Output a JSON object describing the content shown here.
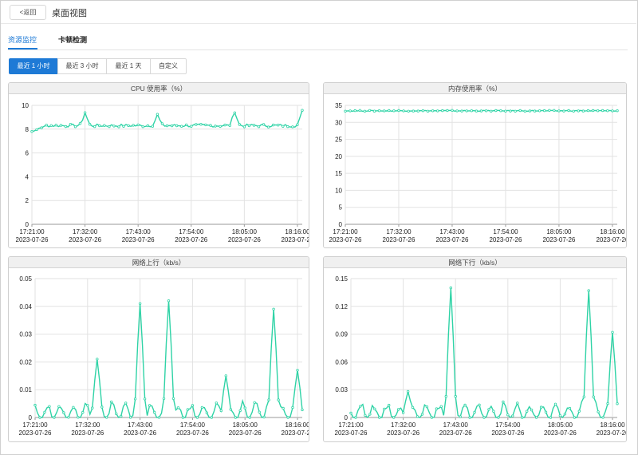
{
  "header": {
    "back_label": "<返回",
    "title": "桌面视图"
  },
  "tabs": [
    {
      "label": "资源监控",
      "active": true
    },
    {
      "label": "卡顿检测",
      "active": false
    }
  ],
  "time_range": {
    "options": [
      "最近 1 小时",
      "最近 3 小时",
      "最近 1 天",
      "自定义"
    ],
    "selected": "最近 1 小时"
  },
  "colors": {
    "accent": "#1e7ad6",
    "series": "#2fd3a6"
  },
  "chart_data": [
    {
      "type": "line",
      "title": "CPU 使用率（%）",
      "x_tick_times": [
        "17:21:00",
        "17:32:00",
        "17:43:00",
        "17:54:00",
        "18:05:00",
        "18:16:00"
      ],
      "x_tick_date": "2023-07-26",
      "x_range_minutes": [
        0,
        56
      ],
      "ylim": [
        0,
        10
      ],
      "y_ticks": [
        0,
        2,
        4,
        6,
        8,
        10
      ],
      "grid": true,
      "series": [
        {
          "peaks": [
            {
              "minute": 11,
              "value": 9.4
            },
            {
              "minute": 26,
              "value": 9.2
            },
            {
              "minute": 42,
              "value": 9.5
            },
            {
              "minute": 56,
              "value": 9.5
            }
          ],
          "baseline": 8.3,
          "start_value": 7.8
        }
      ]
    },
    {
      "type": "line",
      "title": "内存使用率（%）",
      "x_tick_times": [
        "17:21:00",
        "17:32:00",
        "17:43:00",
        "17:54:00",
        "18:05:00",
        "18:16:00"
      ],
      "x_tick_date": "2023-07-26",
      "x_range_minutes": [
        0,
        56
      ],
      "ylim": [
        0,
        35
      ],
      "y_ticks": [
        0,
        5,
        10,
        15,
        20,
        25,
        30,
        35
      ],
      "grid": true,
      "series": [
        {
          "constant": 33.4
        }
      ]
    },
    {
      "type": "line",
      "title": "网络上行（kb/s）",
      "x_tick_times": [
        "17:21:00",
        "17:32:00",
        "17:43:00",
        "17:54:00",
        "18:05:00",
        "18:16:00"
      ],
      "x_tick_date": "2023-07-26",
      "x_range_minutes": [
        0,
        56
      ],
      "ylim": [
        0,
        0.05
      ],
      "y_ticks": [
        0,
        0.01,
        0.02,
        0.03,
        0.04,
        0.05
      ],
      "grid": true,
      "series": [
        {
          "peaks": [
            {
              "minute": 13,
              "value": 0.021
            },
            {
              "minute": 22,
              "value": 0.041
            },
            {
              "minute": 28,
              "value": 0.042
            },
            {
              "minute": 40,
              "value": 0.015
            },
            {
              "minute": 50,
              "value": 0.039
            },
            {
              "minute": 55,
              "value": 0.017
            }
          ],
          "baseline": 0
        }
      ]
    },
    {
      "type": "line",
      "title": "网络下行（kb/s）",
      "x_tick_times": [
        "17:21:00",
        "17:32:00",
        "17:43:00",
        "17:54:00",
        "18:05:00",
        "18:16:00"
      ],
      "x_tick_date": "2023-07-26",
      "x_range_minutes": [
        0,
        56
      ],
      "ylim": [
        0,
        0.15
      ],
      "y_ticks": [
        0,
        0.03,
        0.06,
        0.09,
        0.12,
        0.15
      ],
      "grid": true,
      "series": [
        {
          "peaks": [
            {
              "minute": 12,
              "value": 0.028
            },
            {
              "minute": 21,
              "value": 0.14
            },
            {
              "minute": 50,
              "value": 0.137
            },
            {
              "minute": 55,
              "value": 0.092
            }
          ],
          "baseline": 0
        }
      ]
    }
  ]
}
